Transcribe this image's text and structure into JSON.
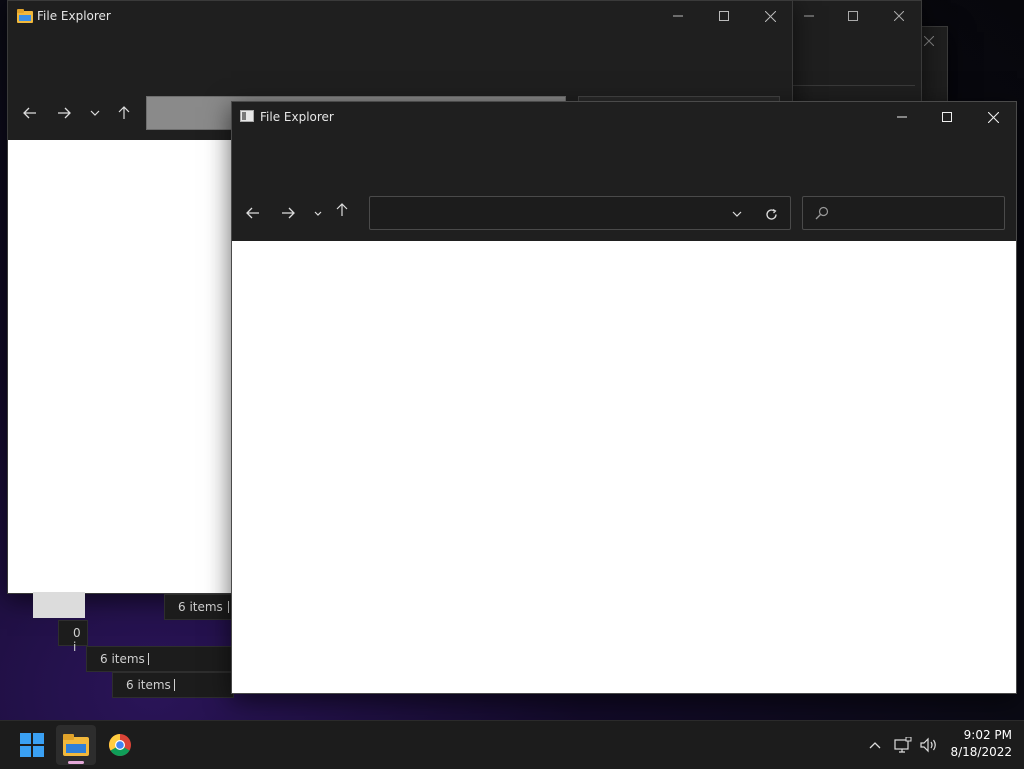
{
  "windows": {
    "back_window": {
      "title": "File Explorer"
    },
    "front_window": {
      "title": "File Explorer",
      "address_value": "",
      "search_placeholder": ""
    }
  },
  "status_bars": [
    {
      "text": "6 items"
    },
    {
      "text": "0 i"
    },
    {
      "text": "6 items"
    },
    {
      "text": "6 items"
    }
  ],
  "taskbar": {
    "time": "9:02 PM",
    "date": "8/18/2022",
    "icons": [
      "windows-start-icon",
      "file-explorer-icon",
      "chrome-icon"
    ],
    "tray_icons": [
      "chevron-up-icon",
      "network-icon",
      "volume-icon"
    ]
  },
  "colors": {
    "window_bg": "#1f1f1f",
    "content_bg": "#ffffff",
    "taskbar_bg": "#1c1c1c",
    "accent": "#0078d4"
  }
}
